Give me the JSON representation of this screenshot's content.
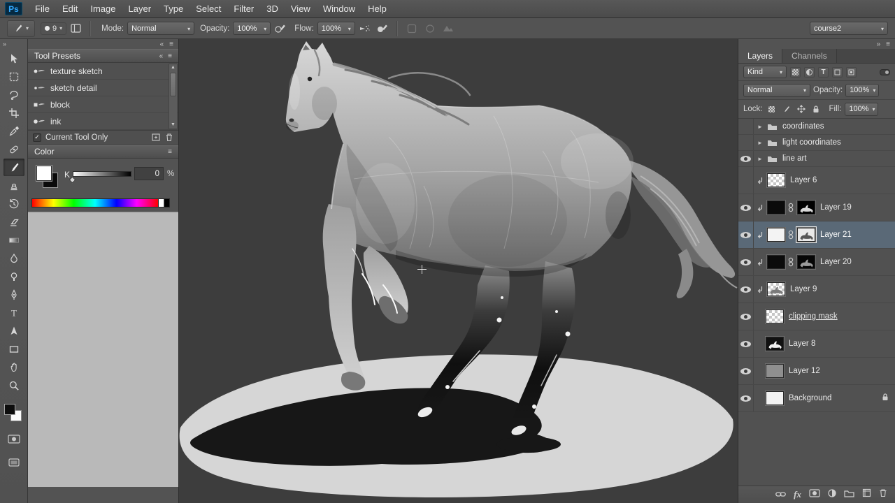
{
  "menu": {
    "logo": "Ps",
    "items": [
      "File",
      "Edit",
      "Image",
      "Layer",
      "Type",
      "Select",
      "Filter",
      "3D",
      "View",
      "Window",
      "Help"
    ]
  },
  "options": {
    "brush_size": "9",
    "mode_label": "Mode:",
    "mode_value": "Normal",
    "opacity_label": "Opacity:",
    "opacity_value": "100%",
    "flow_label": "Flow:",
    "flow_value": "100%",
    "workspace": "course2"
  },
  "tool_presets": {
    "title": "Tool Presets",
    "presets": [
      "texture sketch",
      "sketch detail",
      "block",
      "ink"
    ],
    "current_tool_only": "Current Tool Only"
  },
  "color_panel": {
    "title": "Color",
    "channel_label": "K",
    "value": "0",
    "unit": "%"
  },
  "layers_panel": {
    "tab_layers": "Layers",
    "tab_channels": "Channels",
    "kind_label": "Kind",
    "blend_mode": "Normal",
    "opacity_label": "Opacity:",
    "opacity_value": "100%",
    "lock_label": "Lock:",
    "fill_label": "Fill:",
    "fill_value": "100%",
    "fx_label": "fx",
    "layers": [
      {
        "name": "coordinates"
      },
      {
        "name": "light coordinates"
      },
      {
        "name": "line art"
      },
      {
        "name": "Layer 6"
      },
      {
        "name": "Layer 19"
      },
      {
        "name": "Layer 21"
      },
      {
        "name": "Layer 20"
      },
      {
        "name": "Layer 9"
      },
      {
        "name": "clipping mask"
      },
      {
        "name": "Layer 8"
      },
      {
        "name": "Layer 12"
      },
      {
        "name": "Background"
      }
    ]
  },
  "colors": {
    "accent_blue": "#31a8ff",
    "selected_layer_row": "#5a6977",
    "canvas_background": "#3d3d3d"
  },
  "icons": {
    "dropdown-arrow": "▾",
    "group-closed-arrow": "►",
    "panel-collapse": "«",
    "dock-collapse": "»",
    "panel-menu": "≡",
    "checkbox-check": "✓"
  }
}
